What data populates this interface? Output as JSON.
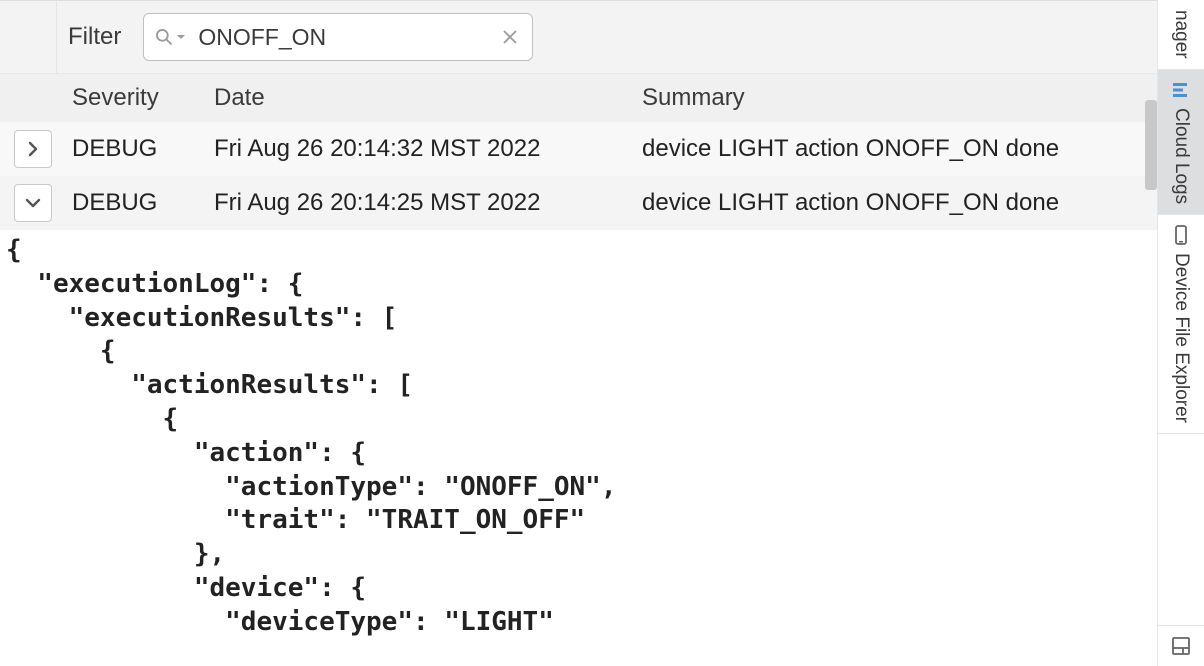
{
  "filter": {
    "label": "Filter",
    "value": "ONOFF_ON"
  },
  "columns": {
    "severity": "Severity",
    "date": "Date",
    "summary": "Summary"
  },
  "rows": [
    {
      "expanded": false,
      "severity": "DEBUG",
      "date": "Fri Aug 26 20:14:32 MST 2022",
      "summary": "device LIGHT action ONOFF_ON done"
    },
    {
      "expanded": true,
      "severity": "DEBUG",
      "date": "Fri Aug 26 20:14:25 MST 2022",
      "summary": "device LIGHT action ONOFF_ON done"
    }
  ],
  "detail_json": "{\n  \"executionLog\": {\n    \"executionResults\": [\n      {\n        \"actionResults\": [\n          {\n            \"action\": {\n              \"actionType\": \"ONOFF_ON\",\n              \"trait\": \"TRAIT_ON_OFF\"\n            },\n            \"device\": {\n              \"deviceType\": \"LIGHT\"",
  "rail": {
    "top_partial": "nager",
    "cloud_logs": "Cloud Logs",
    "device_file_explorer": "Device File Explorer"
  }
}
